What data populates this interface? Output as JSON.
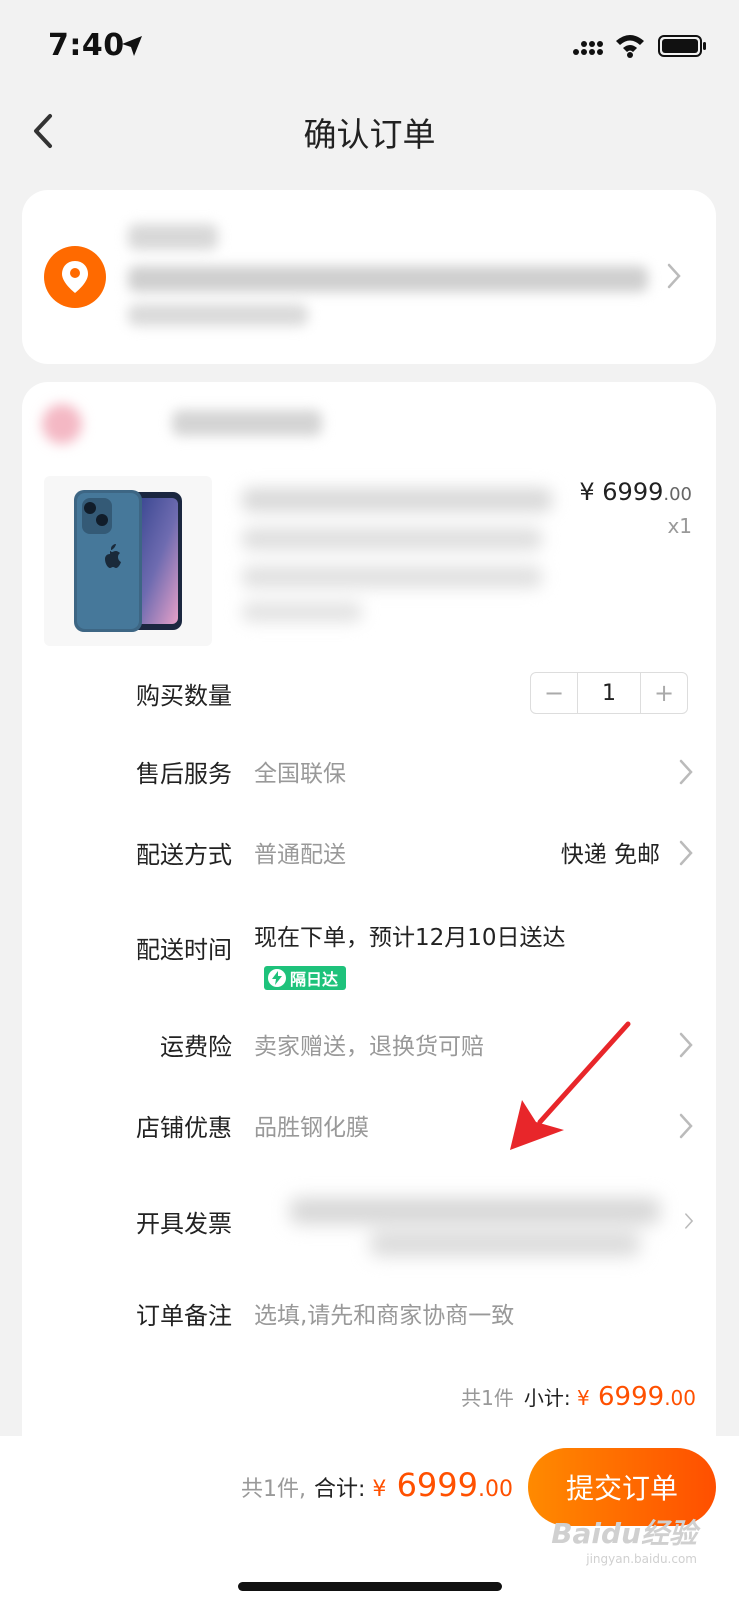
{
  "status_bar": {
    "time": "7:40"
  },
  "nav": {
    "title": "确认订单"
  },
  "product": {
    "currency": "¥",
    "price_int": "6999",
    "price_dec": ".00",
    "quantity_label": "x1"
  },
  "quantity": {
    "label": "购买数量",
    "value": "1",
    "minus": "−",
    "plus": "+"
  },
  "after_sales": {
    "label": "售后服务",
    "value": "全国联保"
  },
  "delivery_method": {
    "label": "配送方式",
    "value": "普通配送",
    "right": "快递 免邮"
  },
  "delivery_time": {
    "label": "配送时间",
    "value": "现在下单，预计12月10日送达",
    "badge": "隔日达"
  },
  "shipping_insurance": {
    "label": "运费险",
    "value": "卖家赠送，退换货可赔"
  },
  "shop_discount": {
    "label": "店铺优惠",
    "value": "品胜钢化膜"
  },
  "invoice": {
    "label": "开具发票"
  },
  "note": {
    "label": "订单备注",
    "placeholder": "选填,请先和商家协商一致"
  },
  "subtotal": {
    "count": "共1件",
    "label": "小计:",
    "currency": "¥",
    "amount_int": "6999",
    "amount_dec": ".00"
  },
  "bottom": {
    "count": "共1件,",
    "label": "合计:",
    "currency": "¥",
    "amount_int": "6999",
    "amount_dec": ".00",
    "submit": "提交订单"
  },
  "watermark": {
    "text": "Baidu经验",
    "sub": "jingyan.baidu.com"
  },
  "colors": {
    "accent": "#ff5000",
    "badge": "#1ec27b",
    "pin": "#ff6a00",
    "arrow": "#e8262a"
  }
}
